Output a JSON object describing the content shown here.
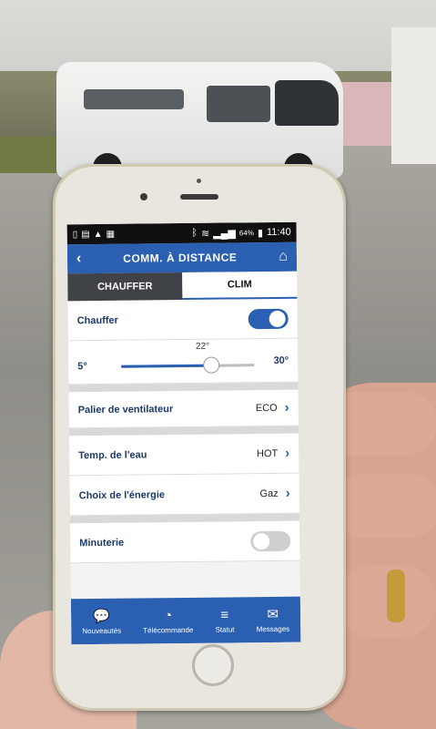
{
  "status_bar": {
    "time": "11:40",
    "battery": "64%"
  },
  "app_bar": {
    "title": "COMM. À DISTANCE"
  },
  "tabs": [
    {
      "label": "CHAUFFER",
      "active": false
    },
    {
      "label": "CLIM",
      "active": true
    }
  ],
  "chauffer": {
    "label": "Chauffer",
    "on": true
  },
  "temperature": {
    "min": "5°",
    "max": "30°",
    "current": "22°",
    "value_fraction": 0.68
  },
  "ventilateur": {
    "label": "Palier de ventilateur",
    "value": "ECO"
  },
  "eau": {
    "label": "Temp. de l'eau",
    "value": "HOT"
  },
  "energie": {
    "label": "Choix de l'énergie",
    "value": "Gaz"
  },
  "minuterie": {
    "label": "Minuterie",
    "on": false
  },
  "bottom_nav": [
    {
      "label": "Nouveautés",
      "icon": "chat-icon"
    },
    {
      "label": "Télécommande",
      "icon": "remote-icon"
    },
    {
      "label": "Statut",
      "icon": "status-icon"
    },
    {
      "label": "Messages",
      "icon": "envelope-icon"
    }
  ],
  "colors": {
    "accent": "#2a5fb2",
    "tab_inactive": "#3f4246"
  }
}
